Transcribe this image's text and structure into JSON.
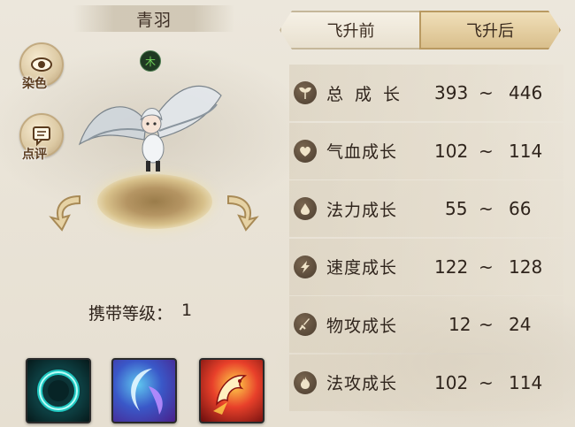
{
  "pet": {
    "name": "青羽",
    "element": "木"
  },
  "side_buttons": {
    "dye_label": "染色",
    "review_label": "点评"
  },
  "carry_level": {
    "label": "携带等级：",
    "value": "1"
  },
  "tabs": {
    "before_label": "飞升前",
    "after_label": "飞升后",
    "active": "飞升后"
  },
  "stats": [
    {
      "label": "总成长",
      "min": "393",
      "sep": "~",
      "max": "446",
      "icon": "growth-icon"
    },
    {
      "label": "气血成长",
      "min": "102",
      "sep": "~",
      "max": "114",
      "icon": "heart-icon"
    },
    {
      "label": "法力成长",
      "min": "55",
      "sep": "~",
      "max": "66",
      "icon": "drop-icon"
    },
    {
      "label": "速度成长",
      "min": "122",
      "sep": "~",
      "max": "128",
      "icon": "lightning-icon"
    },
    {
      "label": "物攻成长",
      "min": "12",
      "sep": "~",
      "max": "24",
      "icon": "sword-icon"
    },
    {
      "label": "法攻成长",
      "min": "102",
      "sep": "~",
      "max": "114",
      "icon": "flame-icon"
    }
  ],
  "skills": [
    {
      "icon": "ring-skill-icon",
      "color": "#1fc6c0"
    },
    {
      "icon": "crescent-skill-icon",
      "color": "#8a4fd8"
    },
    {
      "icon": "phoenix-skill-icon",
      "color": "#e8402a"
    }
  ],
  "colors": {
    "active_tab": "#d9bf8c",
    "text": "#2f241c",
    "element_green": "#72d35a"
  }
}
